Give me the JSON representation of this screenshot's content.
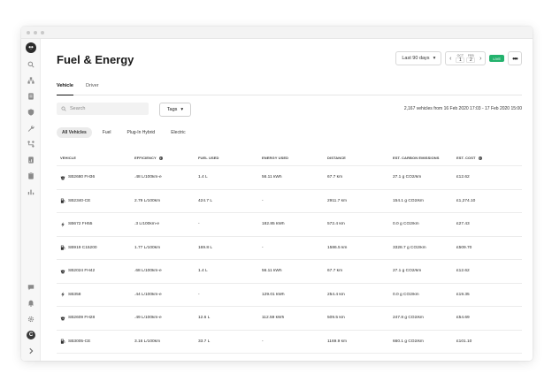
{
  "page": {
    "title": "Fuel & Energy"
  },
  "header": {
    "date_range": "Last 90 days",
    "date_from": {
      "month": "OCT",
      "day": "1"
    },
    "date_to": {
      "month": "FEB",
      "day": "2"
    },
    "live_label": "LIVE",
    "more_label": "•••"
  },
  "tabs": [
    {
      "label": "Vehicle"
    },
    {
      "label": "Driver"
    }
  ],
  "search": {
    "placeholder": "Search"
  },
  "tags": {
    "label": "Tags"
  },
  "count_text": "2,167 vehicles from 16 Feb 2020 17:03 - 17 Feb 2020 15:00",
  "filters": [
    {
      "label": "All Vehicles"
    },
    {
      "label": "Fuel"
    },
    {
      "label": "Plug-In Hybrid"
    },
    {
      "label": "Electric"
    }
  ],
  "columns": [
    "VEHICLE",
    "EFFICIENCY",
    "FUEL USED",
    "ENERGY USED",
    "DISTANCE",
    "EST. CARBON EMISSIONS",
    "EST. COST"
  ],
  "rows": [
    {
      "icon": "hybrid-icon",
      "vehicle": "SB2680 FH36",
      "efficiency": ".48 L/100km-e",
      "fuel": "1.4 L",
      "energy": "56.11 kWh",
      "distance": "67.7 km",
      "carbon": "27.1 g CO2/km",
      "cost": "£12.62"
    },
    {
      "icon": "fuel-pump-icon",
      "vehicle": "SB2340-CE",
      "efficiency": "2.79 L/100km",
      "fuel": "424.7 L",
      "energy": "-",
      "distance": "2911.7 km",
      "carbon": "154.1 g CO2/km",
      "cost": "£1,274.10"
    },
    {
      "icon": "electric-bolt-icon",
      "vehicle": "SB672 FH55",
      "efficiency": ".3 L/100km-e",
      "fuel": "-",
      "energy": "182.85 kWh",
      "distance": "572.4 km",
      "carbon": "0.0 g CO2/km",
      "cost": "£27.43"
    },
    {
      "icon": "fuel-pump-icon",
      "vehicle": "SB919 C15200",
      "efficiency": "1.77 L/100km",
      "fuel": "169.8 L",
      "energy": "-",
      "distance": "1586.5 km",
      "carbon": "3328.7 g CO2/km",
      "cost": "£509.70"
    },
    {
      "icon": "hybrid-icon",
      "vehicle": "SB2024 FH42",
      "efficiency": ".68 L/100km-e",
      "fuel": "1.4 L",
      "energy": "56.11 kWh",
      "distance": "67.7 km",
      "carbon": "27.1 g CO2/km",
      "cost": "£12.62"
    },
    {
      "icon": "electric-bolt-icon",
      "vehicle": "SB358",
      "efficiency": ".44 L/100km-e",
      "fuel": "-",
      "energy": "129.01 kWh",
      "distance": "254.4 km",
      "carbon": "0.0 g CO2/km",
      "cost": "£19.35"
    },
    {
      "icon": "hybrid-icon",
      "vehicle": "SB2609 FH28",
      "efficiency": ".49 L/100km-e",
      "fuel": "12.6 L",
      "energy": "112.59 kWh",
      "distance": "509.5 km",
      "carbon": "247.8 g CO2/km",
      "cost": "£54.69"
    },
    {
      "icon": "fuel-pump-icon",
      "vehicle": "SB3005-CE",
      "efficiency": "3.16 L/100km",
      "fuel": "33.7 L",
      "energy": "-",
      "distance": "1169.9 km",
      "carbon": "660.1 g CO2/km",
      "cost": "£101.10"
    }
  ]
}
